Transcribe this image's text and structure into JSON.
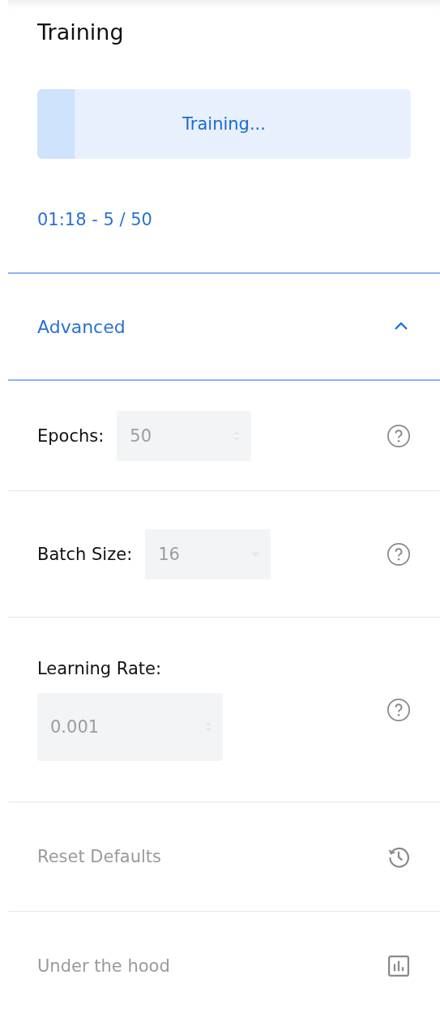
{
  "title": "Training",
  "progress": {
    "label": "Training...",
    "level": 0.1
  },
  "status": "01:18 - 5 / 50",
  "advanced": {
    "label": "Advanced",
    "expanded": true
  },
  "settings": [
    {
      "kind": "number",
      "label": "Epochs:",
      "value": "50",
      "disabled": true,
      "stacked": false
    },
    {
      "kind": "select",
      "label": "Batch Size:",
      "value": "16",
      "disabled": true,
      "stacked": false
    },
    {
      "kind": "number",
      "label": "Learning Rate:",
      "value": "0.001",
      "disabled": true,
      "stacked": true
    }
  ],
  "actions": [
    {
      "kind": "history",
      "label": "Reset Defaults",
      "disabled": true
    },
    {
      "kind": "chart",
      "label": "Under the hood",
      "disabled": true
    }
  ]
}
